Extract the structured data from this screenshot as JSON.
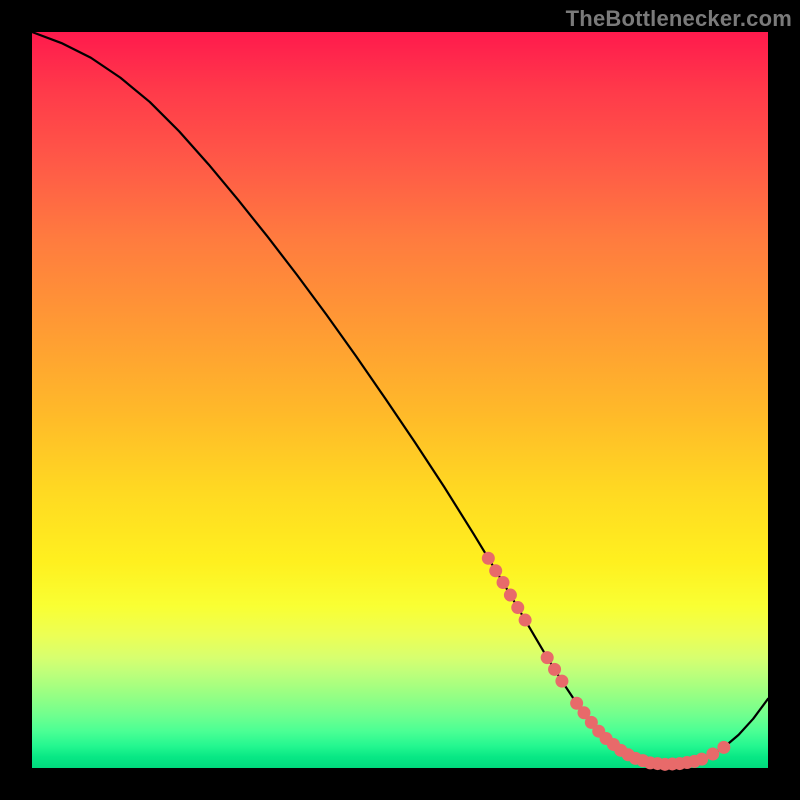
{
  "watermark": "TheBottlenecker.com",
  "colors": {
    "background": "#000000",
    "curve": "#000000",
    "dot": "#e86a6a"
  },
  "chart_data": {
    "type": "line",
    "title": "",
    "xlabel": "",
    "ylabel": "",
    "xlim": [
      0,
      100
    ],
    "ylim": [
      0,
      100
    ],
    "series": [
      {
        "name": "curve",
        "x": [
          0,
          4,
          8,
          12,
          16,
          20,
          24,
          28,
          32,
          36,
          40,
          44,
          48,
          52,
          56,
          60,
          62,
          64,
          66,
          68,
          70,
          72,
          74,
          76,
          78,
          80,
          82,
          84,
          86,
          88,
          90,
          92,
          94,
          96,
          98,
          100
        ],
        "y": [
          100,
          98.5,
          96.5,
          93.8,
          90.5,
          86.5,
          82,
          77.2,
          72.2,
          67,
          61.6,
          56,
          50.2,
          44.3,
          38.2,
          31.8,
          28.5,
          25.2,
          21.8,
          18.4,
          15.0,
          11.8,
          8.8,
          6.2,
          4.0,
          2.4,
          1.3,
          0.7,
          0.5,
          0.6,
          0.9,
          1.6,
          2.8,
          4.5,
          6.7,
          9.4
        ]
      }
    ],
    "points": [
      {
        "x": 62.0,
        "y": 28.5
      },
      {
        "x": 63.0,
        "y": 26.8
      },
      {
        "x": 64.0,
        "y": 25.2
      },
      {
        "x": 65.0,
        "y": 23.5
      },
      {
        "x": 66.0,
        "y": 21.8
      },
      {
        "x": 67.0,
        "y": 20.1
      },
      {
        "x": 70.0,
        "y": 15.0
      },
      {
        "x": 71.0,
        "y": 13.4
      },
      {
        "x": 72.0,
        "y": 11.8
      },
      {
        "x": 74.0,
        "y": 8.8
      },
      {
        "x": 75.0,
        "y": 7.5
      },
      {
        "x": 76.0,
        "y": 6.2
      },
      {
        "x": 77.0,
        "y": 5.0
      },
      {
        "x": 78.0,
        "y": 4.0
      },
      {
        "x": 79.0,
        "y": 3.2
      },
      {
        "x": 80.0,
        "y": 2.4
      },
      {
        "x": 81.0,
        "y": 1.8
      },
      {
        "x": 82.0,
        "y": 1.3
      },
      {
        "x": 83.0,
        "y": 1.0
      },
      {
        "x": 84.0,
        "y": 0.7
      },
      {
        "x": 85.0,
        "y": 0.6
      },
      {
        "x": 86.0,
        "y": 0.5
      },
      {
        "x": 87.0,
        "y": 0.55
      },
      {
        "x": 88.0,
        "y": 0.6
      },
      {
        "x": 89.0,
        "y": 0.75
      },
      {
        "x": 90.0,
        "y": 0.9
      },
      {
        "x": 91.0,
        "y": 1.2
      },
      {
        "x": 92.5,
        "y": 1.9
      },
      {
        "x": 94.0,
        "y": 2.8
      }
    ]
  }
}
